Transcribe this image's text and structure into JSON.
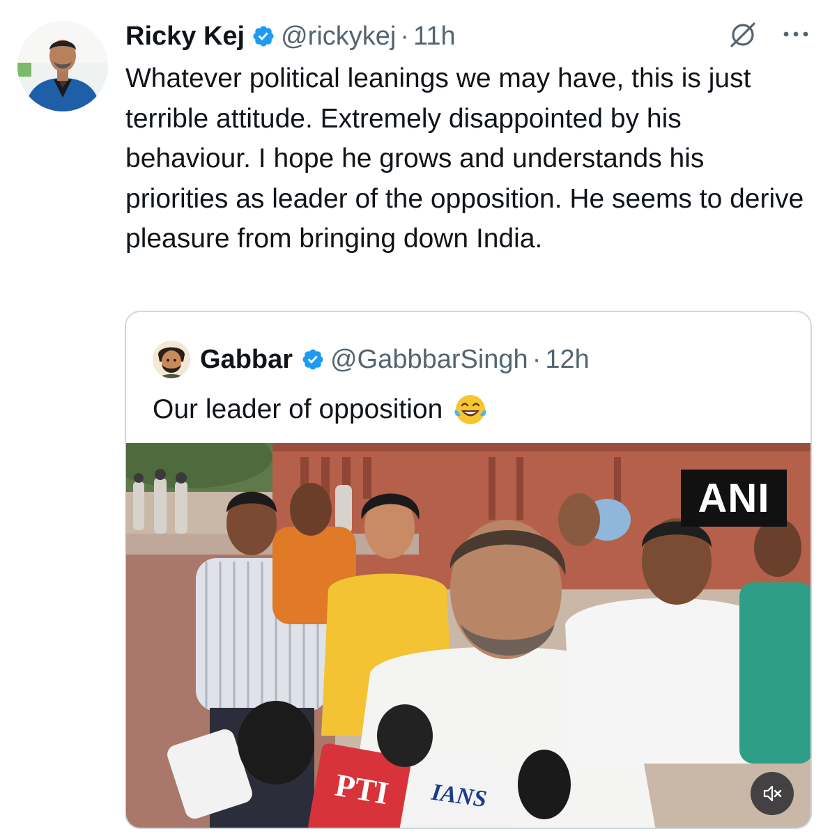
{
  "tweet": {
    "author_name": "Ricky Kej",
    "handle": "@rickykej",
    "separator": "·",
    "time": "11h",
    "text": "Whatever political leanings we may have, this is just terrible attitude. Extremely disappointed by his behaviour. I hope he grows and understands his priorities as leader of the opposition. He seems to derive pleasure from bringing down India.",
    "verified": true
  },
  "quote": {
    "author_name": "Gabbar",
    "handle": "@GabbbarSingh",
    "separator": "·",
    "time": "12h",
    "text": "Our leader of opposition",
    "emoji": "face-with-tears-of-joy",
    "verified": true
  },
  "media": {
    "watermark": "ANI",
    "mic_labels": [
      "PTI",
      "IANS"
    ],
    "muted": true
  },
  "icons": {
    "grok": "slashed-circle-icon",
    "more": "more-dots-icon",
    "verified": "verified-badge-icon",
    "mute": "volume-muted-icon"
  },
  "colors": {
    "verified_blue": "#1d9bf0",
    "text_primary": "#0f1419",
    "text_secondary": "#536471",
    "border": "#cfd9de"
  }
}
